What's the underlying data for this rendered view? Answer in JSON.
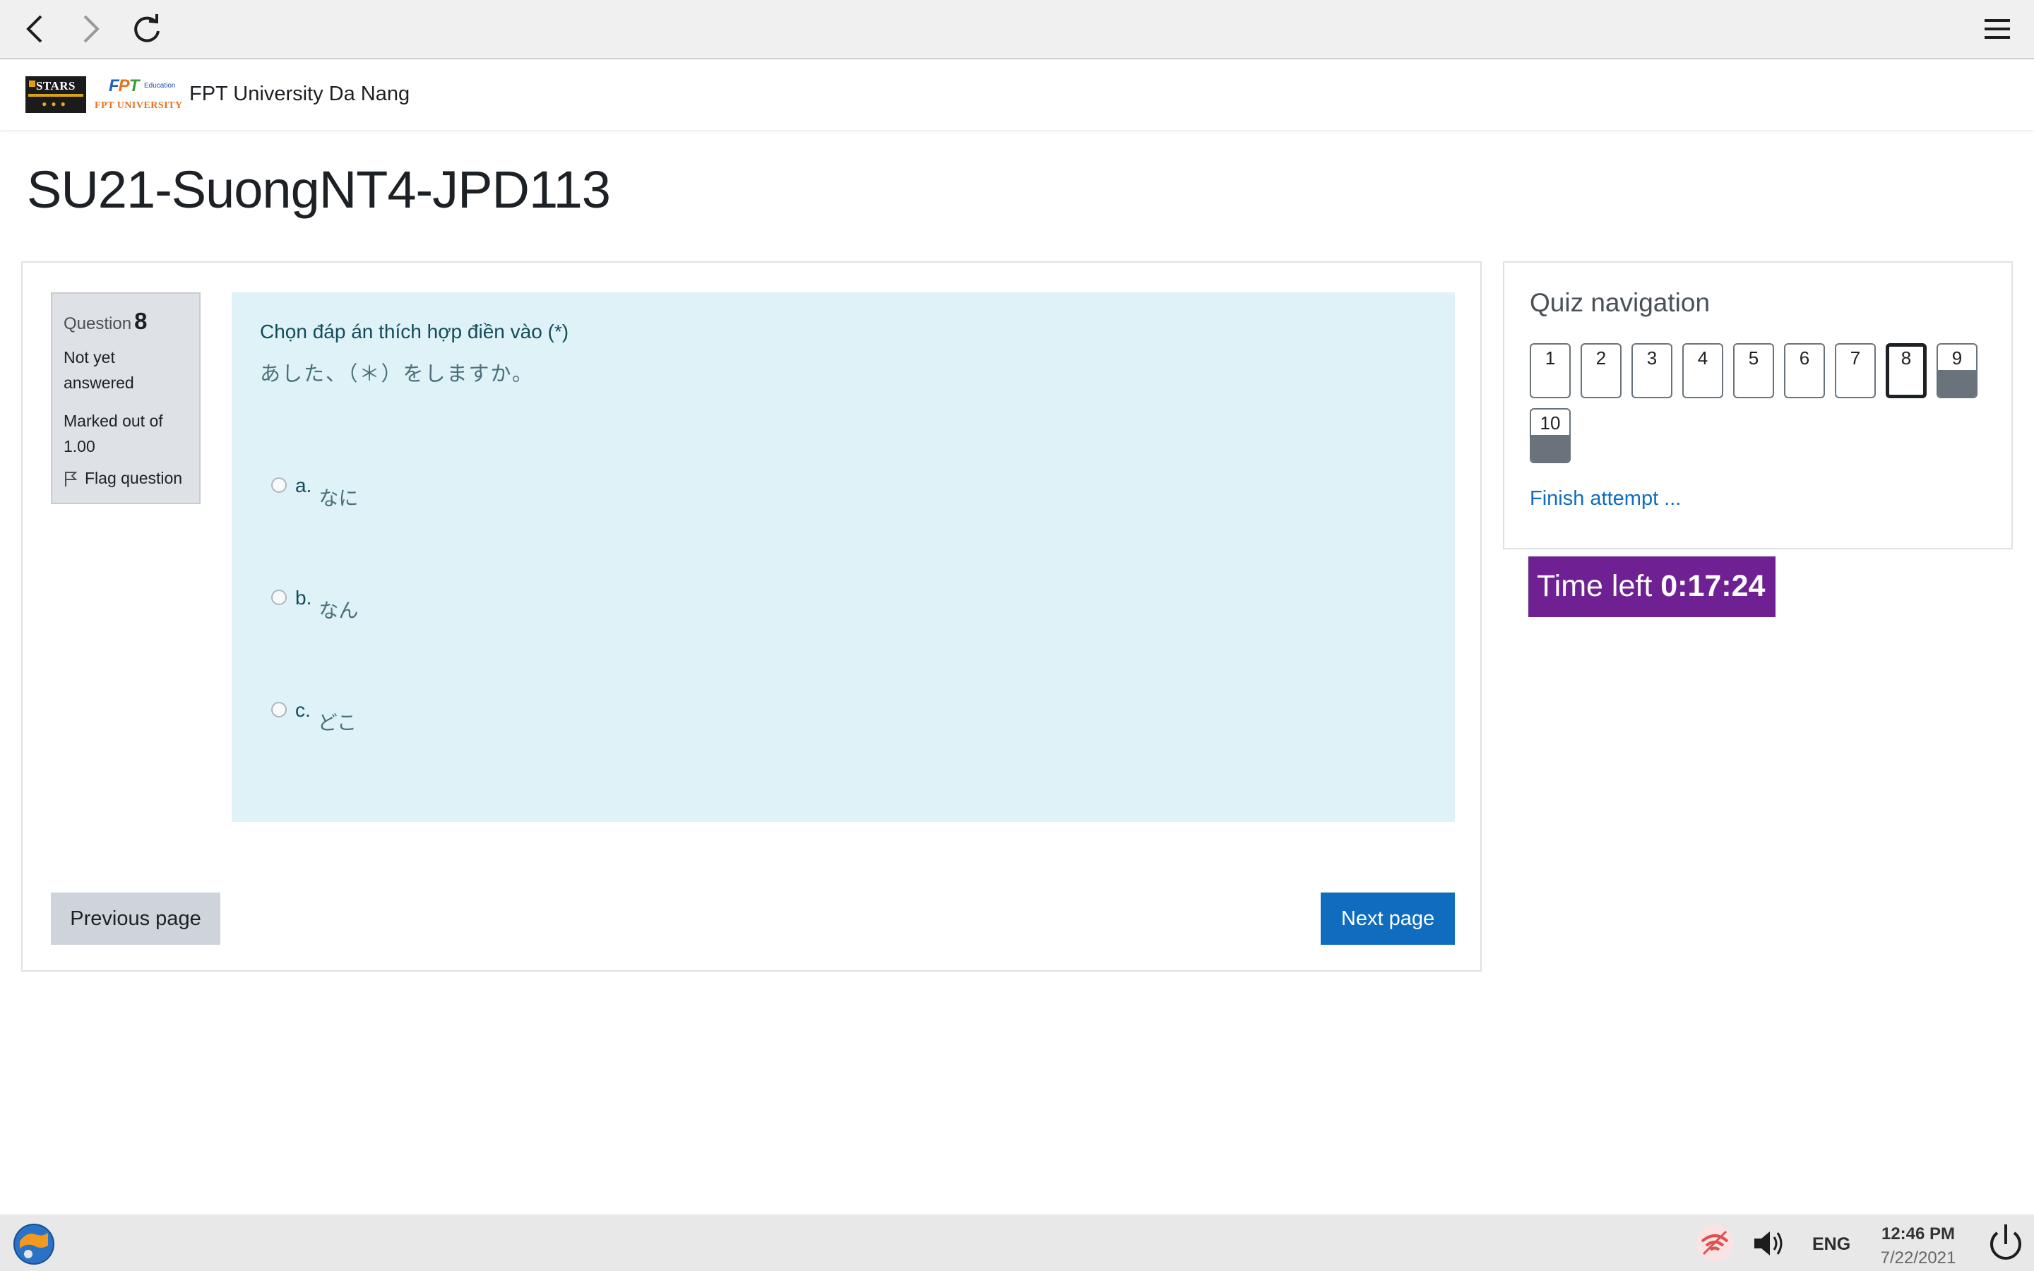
{
  "browser": {
    "icons": [
      "back-icon",
      "forward-icon",
      "reload-icon",
      "hamburger-menu-icon"
    ]
  },
  "header": {
    "site_name": "FPT University Da Nang",
    "logo_stars_text": "STARS",
    "logo_fpt_text": "FPT",
    "logo_fpt_edu": "Education",
    "logo_fpt_uni": "FPT UNIVERSITY"
  },
  "page": {
    "title": "SU21-SuongNT4-JPD113"
  },
  "question_info": {
    "label": "Question",
    "number": "8",
    "state_line1": "Not yet",
    "state_line2": "answered",
    "grade_line1": "Marked out of",
    "grade_line2": "1.00",
    "flag_label": "Flag question"
  },
  "question": {
    "prompt": "Chọn đáp án thích hợp điền vào (*)",
    "sentence": "あした、（＊）をしますか。",
    "options": [
      {
        "letter": "a.",
        "text": "なに"
      },
      {
        "letter": "b.",
        "text": "なん"
      },
      {
        "letter": "c.",
        "text": "どこ"
      }
    ]
  },
  "navigation": {
    "prev_label": "Previous page",
    "next_label": "Next page"
  },
  "quiz_nav": {
    "title": "Quiz navigation",
    "buttons": [
      {
        "label": "1",
        "state": "not-answered"
      },
      {
        "label": "2",
        "state": "not-answered"
      },
      {
        "label": "3",
        "state": "not-answered"
      },
      {
        "label": "4",
        "state": "not-answered"
      },
      {
        "label": "5",
        "state": "not-answered"
      },
      {
        "label": "6",
        "state": "not-answered"
      },
      {
        "label": "7",
        "state": "not-answered"
      },
      {
        "label": "8",
        "state": "current"
      },
      {
        "label": "9",
        "state": "not-visited"
      },
      {
        "label": "10",
        "state": "not-visited"
      }
    ],
    "finish_label": "Finish attempt ..."
  },
  "timer": {
    "label": "Time left",
    "value": "0:17:24"
  },
  "taskbar": {
    "language": "ENG",
    "time": "12:46 PM",
    "date": "7/22/2021"
  },
  "colors": {
    "accent": "#0f6cbf",
    "timer_bg": "#6f2193",
    "question_bg": "#def2f8",
    "info_bg": "#dee2e6"
  }
}
